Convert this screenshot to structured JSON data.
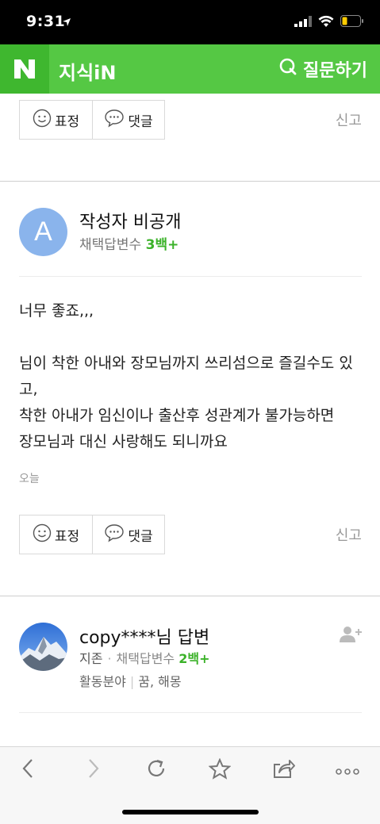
{
  "status_bar": {
    "time": "9:31"
  },
  "header": {
    "logo": "N",
    "title": "지식iN",
    "ask_label": "질문하기"
  },
  "actions": {
    "emotion_label": "표정",
    "comment_label": "댓글",
    "report_label": "신고"
  },
  "comment": {
    "author_initial": "A",
    "author_name": "작성자 비공개",
    "adopted_label": "채택답변수",
    "adopted_count": "3백+",
    "lines": [
      "너무 좋죠,,,",
      "",
      "님이 착한 아내와 장모님까지 쓰리섬으로 즐길수도 있",
      "고,",
      "착한 아내가 임신이나 출산후 성관계가 불가능하면",
      "장모님과 대신 사랑해도 되니까요"
    ],
    "date": "오늘"
  },
  "answer": {
    "name": "copy****님 답변",
    "rank": "지존",
    "adopted_label": "채택답변수",
    "adopted_count": "2백+",
    "field_label": "활동분야",
    "field_value": "꿈, 해몽"
  },
  "icons": {
    "logo": "naver-logo-icon",
    "ask": "search-q-icon",
    "emotion": "smiley-icon",
    "comment": "speech-bubble-icon",
    "follow": "add-person-icon",
    "toolbar": [
      "back-icon",
      "forward-icon",
      "reload-icon",
      "bookmark-star-icon",
      "share-icon",
      "more-icon"
    ]
  },
  "colors": {
    "brand_green": "#55c844",
    "accent_green": "#3bb229",
    "avatar_blue": "#8ab4ec"
  }
}
